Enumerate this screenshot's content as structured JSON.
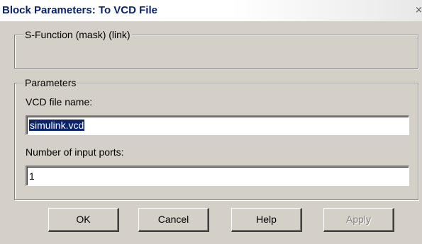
{
  "window": {
    "title": "Block Parameters: To VCD File",
    "close_glyph": "×"
  },
  "groups": {
    "sfunction_legend": "S-Function (mask) (link)",
    "parameters_legend": "Parameters"
  },
  "fields": {
    "vcd_label": "VCD file name:",
    "vcd_value": "simulink.vcd",
    "ports_label": "Number of input ports:",
    "ports_value": "1"
  },
  "buttons": {
    "ok": "OK",
    "cancel": "Cancel",
    "help": "Help",
    "apply": "Apply"
  },
  "state": {
    "apply_enabled": false,
    "vcd_value_selected": true
  }
}
